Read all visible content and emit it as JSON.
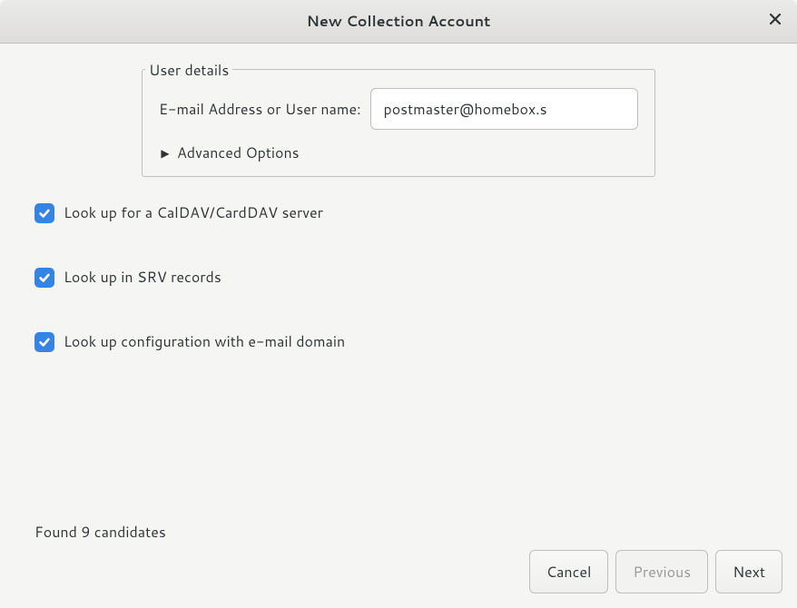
{
  "titlebar": {
    "title": "New Collection Account"
  },
  "user_details": {
    "legend": "User details",
    "email_label": "E-mail Address or User name:",
    "email_value": "postmaster@homebox.s",
    "advanced_label": "Advanced Options"
  },
  "checkboxes": {
    "caldav": {
      "label": "Look up for a CalDAV/CardDAV server",
      "checked": true
    },
    "srv": {
      "label": "Look up in SRV records",
      "checked": true
    },
    "config": {
      "label": "Look up configuration with e-mail domain",
      "checked": true
    }
  },
  "status": {
    "message": "Found 9 candidates"
  },
  "buttons": {
    "cancel": "Cancel",
    "previous": "Previous",
    "next": "Next"
  }
}
